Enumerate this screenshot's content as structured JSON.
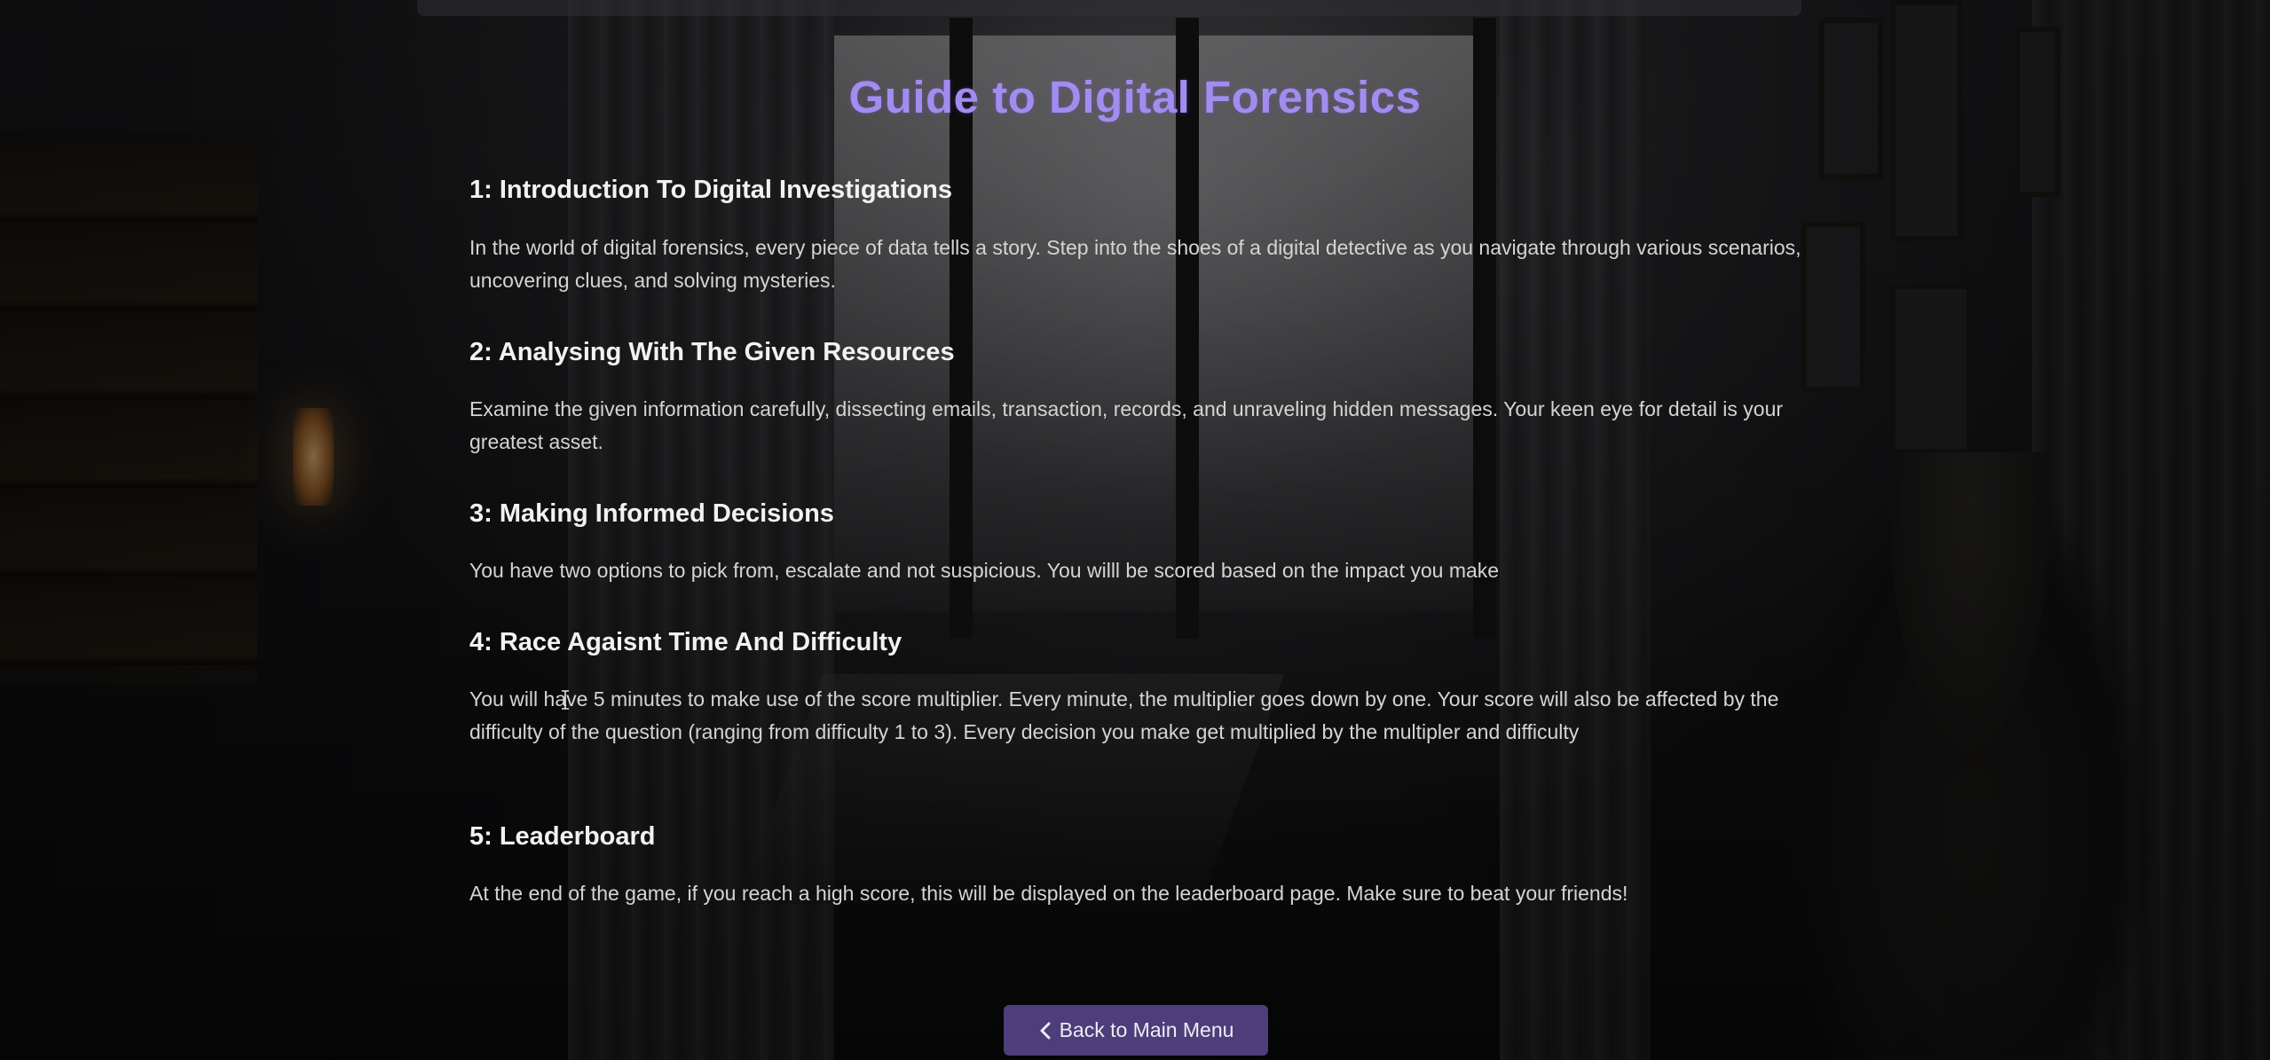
{
  "page": {
    "title": "Guide to Digital Forensics"
  },
  "sections": [
    {
      "heading": "1: Introduction To Digital Investigations",
      "body": "In the world of digital forensics, every piece of data tells a story. Step into the shoes of a digital detective as you navigate through various scenarios, uncovering clues, and solving mysteries."
    },
    {
      "heading": "2: Analysing With The Given Resources",
      "body": "Examine the given information carefully, dissecting emails, transaction, records, and unraveling hidden messages. Your keen eye for detail is your greatest asset."
    },
    {
      "heading": "3: Making Informed Decisions",
      "body": "You have two options to pick from, escalate and not suspicious. You willl be scored based on the impact you make"
    },
    {
      "heading": "4: Race Agaisnt Time And Difficulty",
      "body": "You will have 5 minutes to make use of the score multiplier. Every minute, the multiplier goes down by one. Your score will also be affected by the difficulty of the question (ranging from difficulty 1 to 3). Every decision you make get multiplied by the multipler and difficulty"
    },
    {
      "heading": "5: Leaderboard",
      "body": "At the end of the game, if you reach a high score, this will be displayed on the leaderboard page. Make sure to beat your friends!"
    }
  ],
  "navigation": {
    "back_label": "Back to Main Menu",
    "back_icon": "chevron-left-icon"
  },
  "colors": {
    "title": "#a28cf0",
    "button_bg": "#4d3d7a",
    "heading": "#f2f2f2",
    "body": "#d4d4d4"
  }
}
